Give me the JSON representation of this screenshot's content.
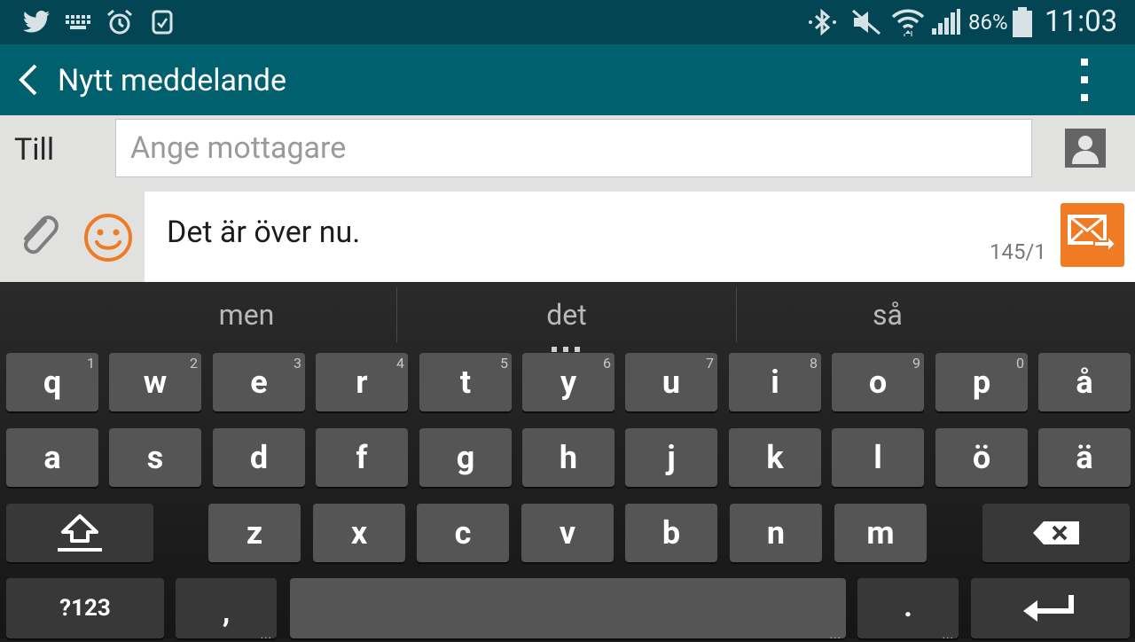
{
  "status_bar": {
    "battery_percent": "86%",
    "time": "11:03"
  },
  "app_bar": {
    "title": "Nytt meddelande"
  },
  "recipient": {
    "label": "Till",
    "placeholder": "Ange mottagare",
    "value": ""
  },
  "message": {
    "text": "Det är över nu.",
    "counter": "145/1"
  },
  "keyboard": {
    "suggestions": [
      "men",
      "det",
      "så"
    ],
    "row1": [
      {
        "char": "q",
        "hint": "1"
      },
      {
        "char": "w",
        "hint": "2"
      },
      {
        "char": "e",
        "hint": "3"
      },
      {
        "char": "r",
        "hint": "4"
      },
      {
        "char": "t",
        "hint": "5"
      },
      {
        "char": "y",
        "hint": "6"
      },
      {
        "char": "u",
        "hint": "7"
      },
      {
        "char": "i",
        "hint": "8"
      },
      {
        "char": "o",
        "hint": "9"
      },
      {
        "char": "p",
        "hint": "0"
      },
      {
        "char": "å",
        "hint": ""
      }
    ],
    "row2": [
      "a",
      "s",
      "d",
      "f",
      "g",
      "h",
      "j",
      "k",
      "l",
      "ö",
      "ä"
    ],
    "row3": [
      "z",
      "x",
      "c",
      "v",
      "b",
      "n",
      "m"
    ],
    "symbols_label": "?123",
    "comma_label": ",",
    "period_label": "."
  }
}
